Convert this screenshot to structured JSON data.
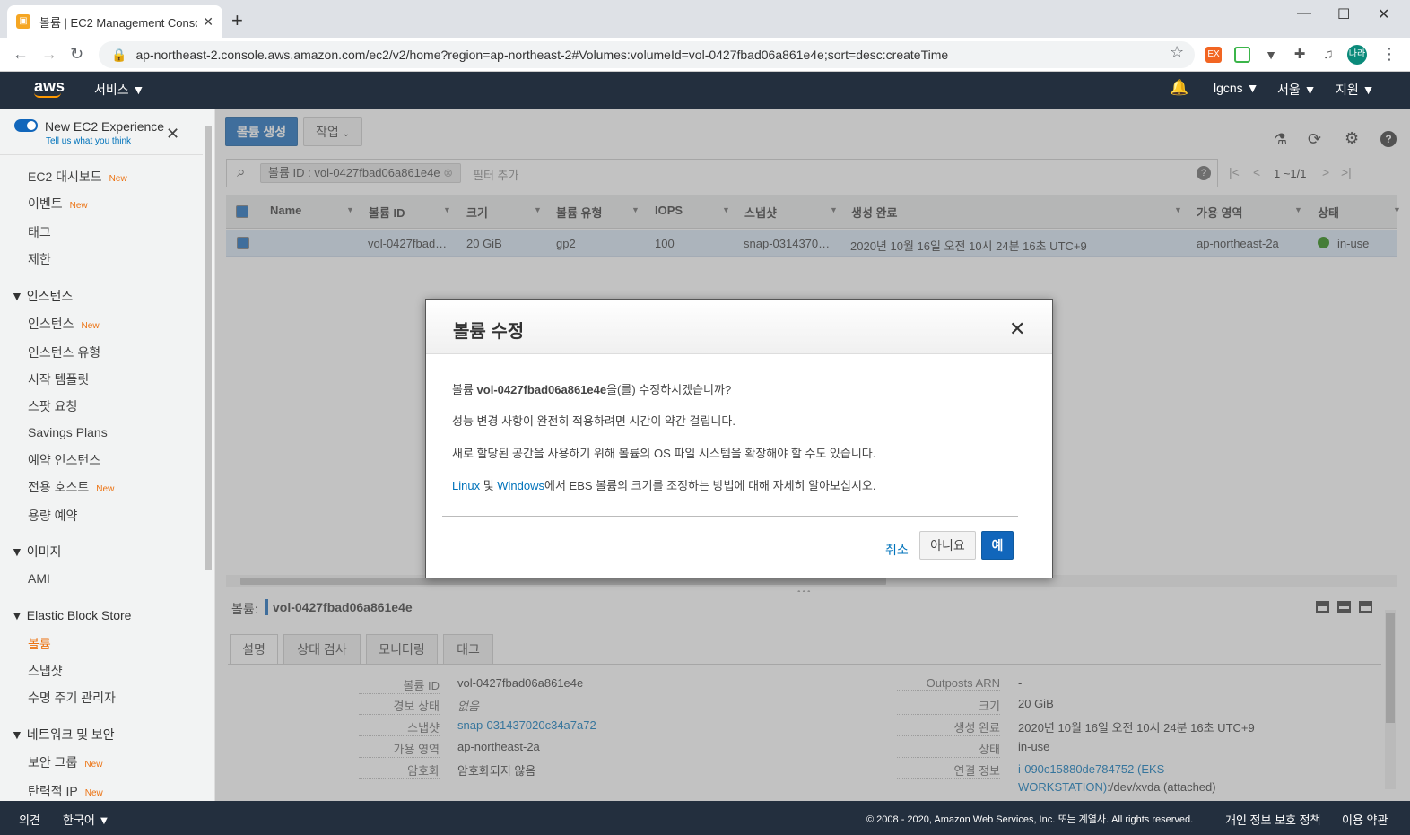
{
  "browser": {
    "tab_title": "볼륨 | EC2 Management Console",
    "tab_close": "✕",
    "new_tab": "+",
    "url": "ap-northeast-2.console.aws.amazon.com/ec2/v2/home?region=ap-northeast-2#Volumes:volumeId=vol-0427fbad06a861e4e;sort=desc:createTime",
    "profile": "나라"
  },
  "header": {
    "logo": "aws",
    "services": "서비스 ▼",
    "account": "lgcns ▼",
    "region": "서울 ▼",
    "support": "지원 ▼"
  },
  "sidebar": {
    "experience_title": "New EC2 Experience",
    "experience_sub": "Tell us what you think",
    "new_badge": "New",
    "items_top": [
      {
        "label": "EC2 대시보드",
        "new": true
      },
      {
        "label": "이벤트",
        "new": true
      },
      {
        "label": "태그",
        "new": false
      },
      {
        "label": "제한",
        "new": false
      }
    ],
    "sec_instances": "인스턴스",
    "instances": [
      {
        "label": "인스턴스",
        "new": true
      },
      {
        "label": "인스턴스 유형",
        "new": false
      },
      {
        "label": "시작 템플릿",
        "new": false
      },
      {
        "label": "스팟 요청",
        "new": false
      },
      {
        "label": "Savings Plans",
        "new": false
      },
      {
        "label": "예약 인스턴스",
        "new": false
      },
      {
        "label": "전용 호스트",
        "new": true
      },
      {
        "label": "용량 예약",
        "new": false
      }
    ],
    "sec_images": "이미지",
    "images": [
      "AMI"
    ],
    "sec_ebs": "Elastic Block Store",
    "ebs": [
      "볼륨",
      "스냅샷",
      "수명 주기 관리자"
    ],
    "sec_network": "네트워크 및 보안",
    "network": [
      {
        "label": "보안 그룹",
        "new": true
      },
      {
        "label": "탄력적 IP",
        "new": true
      }
    ]
  },
  "toolbar": {
    "create_volume": "볼륨 생성",
    "actions": "작업"
  },
  "filter": {
    "chip": "볼륨 ID : vol-0427fbad06a861e4e",
    "placeholder": "필터 추가",
    "pagination": "1 ~1/1"
  },
  "table": {
    "columns": [
      "Name",
      "볼륨 ID",
      "크기",
      "볼륨 유형",
      "IOPS",
      "스냅샷",
      "생성 완료",
      "가용 영역",
      "상태"
    ],
    "row": {
      "name": "",
      "volume_id": "vol-0427fbad…",
      "size": "20 GiB",
      "type": "gp2",
      "iops": "100",
      "snapshot": "snap-0314370…",
      "created": "2020년 10월 16일 오전 10시 24분 16초 UTC+9",
      "az": "ap-northeast-2a",
      "state": "in-use"
    },
    "state_color": "#1d8102"
  },
  "detail": {
    "label": "볼륨:",
    "volume_id": "vol-0427fbad06a861e4e",
    "tabs": [
      "설명",
      "상태 검사",
      "모니터링",
      "태그"
    ],
    "left": [
      {
        "k": "볼륨 ID",
        "v": "vol-0427fbad06a861e4e",
        "link": false
      },
      {
        "k": "경보 상태",
        "v": "없음",
        "link": false
      },
      {
        "k": "스냅샷",
        "v": "snap-031437020c34a7a72",
        "link": true
      },
      {
        "k": "가용 영역",
        "v": "ap-northeast-2a",
        "link": false
      },
      {
        "k": "암호화",
        "v": "암호화되지 않음",
        "link": false
      }
    ],
    "right": [
      {
        "k": "Outposts ARN",
        "v": "-"
      },
      {
        "k": "크기",
        "v": "20 GiB"
      },
      {
        "k": "생성 완료",
        "v": "2020년 10월 16일 오전 10시 24분 16초 UTC+9"
      },
      {
        "k": "상태",
        "v": "in-use"
      },
      {
        "k": "연결 정보",
        "v": ""
      }
    ],
    "attach_link1": "i-090c15880de784752 (EKS-",
    "attach_link2": "WORKSTATION)",
    "attach_rest": ":/dev/xvda (attached)"
  },
  "modal": {
    "title": "볼륨 수정",
    "q_prefix": "볼륨 ",
    "q_bold": "vol-0427fbad06a861e4e",
    "q_suffix": "을(를) 수정하시겠습니까?",
    "line1": "성능 변경 사항이 완전히 적용하려면 시간이 약간 걸립니다.",
    "line2": "새로 할당된 공간을 사용하기 위해 볼륨의 OS 파일 시스템을 확장해야 할 수도 있습니다.",
    "link_linux": "Linux",
    "and": " 및 ",
    "link_windows": "Windows",
    "line3_rest": "에서 EBS 볼륨의 크기를 조정하는 방법에 대해 자세히 알아보십시오.",
    "cancel": "취소",
    "no": "아니요",
    "yes": "예"
  },
  "footer": {
    "feedback": "의견",
    "language": "한국어 ▼",
    "copyright": "© 2008 - 2020, Amazon Web Services, Inc. 또는 계열사. All rights reserved.",
    "privacy": "개인 정보 보호 정책",
    "terms": "이용 약관"
  }
}
